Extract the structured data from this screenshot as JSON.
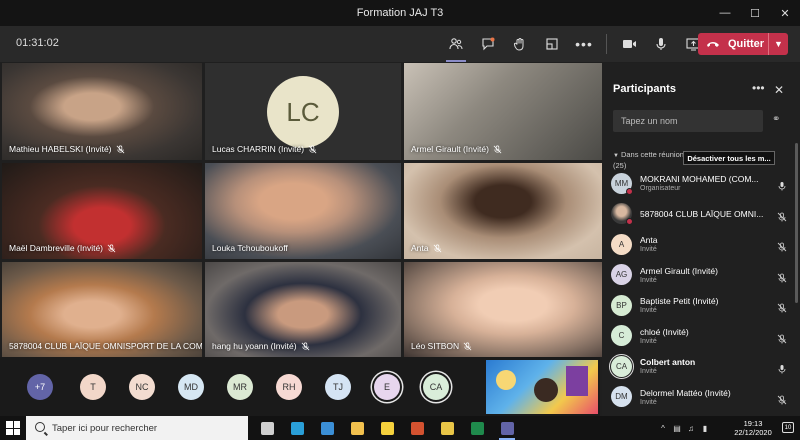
{
  "window": {
    "title": "Formation JAJ T3"
  },
  "toolbar": {
    "timer": "01:31:02",
    "leave_label": "Quitter"
  },
  "videos": [
    {
      "name": "Mathieu HABELSKI (Invité)",
      "muted": true
    },
    {
      "name": "Lucas CHARRIN (Invité)",
      "initials": "LC",
      "muted": true
    },
    {
      "name": "Armel Girault (Invité)",
      "muted": true
    },
    {
      "name": "Maël Dambreville (Invité)",
      "muted": true
    },
    {
      "name": "Louka Tchouboukoff",
      "muted": false
    },
    {
      "name": "Anta",
      "muted": true
    },
    {
      "name": "5878004 CLUB LAÏQUE OMNISPORT DE LA COM...",
      "muted": true
    },
    {
      "name": "hang hu yoann (Invité)",
      "muted": true
    },
    {
      "name": "Léo SITBON",
      "muted": true
    }
  ],
  "strip": {
    "more": "+7",
    "avatars": [
      {
        "initials": "T",
        "color": "#f2d7c9"
      },
      {
        "initials": "NC",
        "color": "#f3dcd0"
      },
      {
        "initials": "MD",
        "color": "#d6e7f3"
      },
      {
        "initials": "MR",
        "color": "#dbe9d3"
      },
      {
        "initials": "RH",
        "color": "#f6d9d3"
      },
      {
        "initials": "TJ",
        "color": "#d5e4f4"
      },
      {
        "initials": "E",
        "color": "#e7d6ee",
        "ring": true
      },
      {
        "initials": "CA",
        "color": "#d9edd9",
        "ring": true
      }
    ]
  },
  "panel": {
    "title": "Participants",
    "search_placeholder": "Tapez un nom",
    "section": "Dans cette réunion (25)",
    "mute_all": "Désactiver tous les m...",
    "participants": [
      {
        "initials": "MM",
        "name": "MOKRANI MOHAMED (COM...",
        "role": "Organisateur",
        "color": "#c9d3dc",
        "mic": "on",
        "dot": true
      },
      {
        "initials": "",
        "name": "5878004 CLUB LAÏQUE OMNI...",
        "role": "",
        "color": "",
        "photo": true,
        "mic": "off",
        "dot": true
      },
      {
        "initials": "A",
        "name": "Anta",
        "role": "Invité",
        "color": "#f4dcc6",
        "mic": "off"
      },
      {
        "initials": "AG",
        "name": "Armel Girault (Invité)",
        "role": "Invité",
        "color": "#d9d3e6",
        "mic": "off"
      },
      {
        "initials": "BP",
        "name": "Baptiste Petit (Invité)",
        "role": "Invité",
        "color": "#d6ebd3",
        "mic": "off"
      },
      {
        "initials": "C",
        "name": "chloé (Invité)",
        "role": "Invité",
        "color": "#d6ecd7",
        "mic": "off"
      },
      {
        "initials": "CA",
        "name": "Colbert anton",
        "role": "Invité",
        "color": "#d9edd9",
        "mic": "on",
        "bold": true,
        "ring": true
      },
      {
        "initials": "DM",
        "name": "Delormel Mattéo (Invité)",
        "role": "Invité",
        "color": "#d6e1ee",
        "mic": "off"
      }
    ]
  },
  "taskbar": {
    "search_placeholder": "Taper ici pour rechercher",
    "time": "19:13",
    "date": "22/12/2020",
    "notifications": "10",
    "apps": [
      {
        "name": "task-view",
        "color": "#cfcfcf"
      },
      {
        "name": "edge",
        "color": "#2a9fd8"
      },
      {
        "name": "mail",
        "color": "#3b8fd6"
      },
      {
        "name": "store",
        "color": "#f2c14e"
      },
      {
        "name": "sticky-notes",
        "color": "#f5d13d"
      },
      {
        "name": "powerpoint",
        "color": "#d35230"
      },
      {
        "name": "chrome",
        "color": "#e8c547"
      },
      {
        "name": "excel",
        "color": "#1f8a4c"
      },
      {
        "name": "teams",
        "color": "#6264a7",
        "open": true
      }
    ]
  }
}
